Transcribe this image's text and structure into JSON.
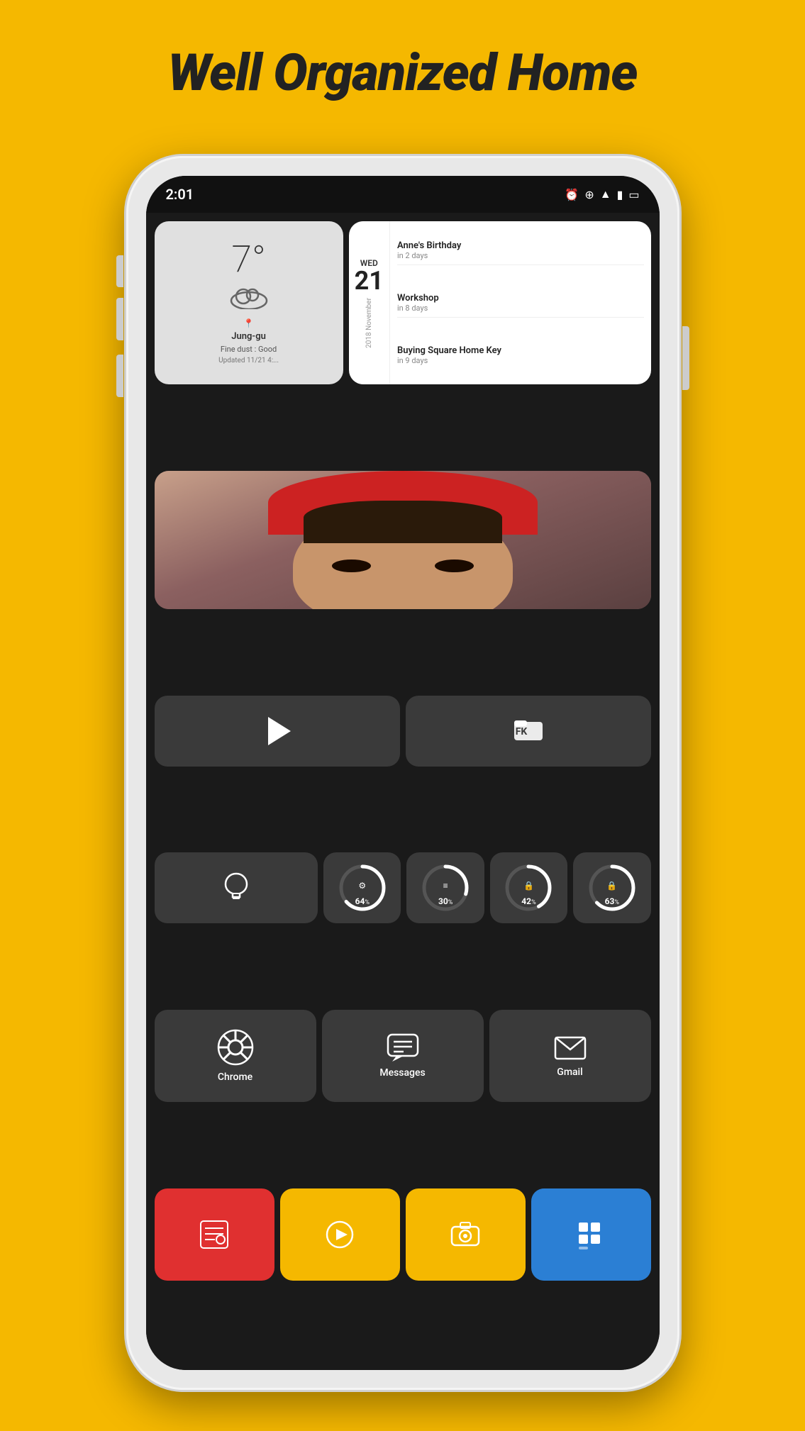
{
  "header": {
    "title": "Well Organized Home"
  },
  "statusBar": {
    "time": "2:01",
    "icons": [
      "alarm-clock",
      "location",
      "wifi",
      "signal",
      "battery"
    ]
  },
  "weatherWidget": {
    "temperature": "7°",
    "location": "Jung-gu",
    "fineDust": "Fine dust : Good",
    "updated": "Updated 11/21 4:...",
    "icon": "cloud"
  },
  "calendarWidget": {
    "dayName": "WED",
    "dayNum": "21",
    "yearMonth": "2018 November",
    "events": [
      {
        "name": "Anne's Birthday",
        "days": "in 2 days"
      },
      {
        "name": "Workshop",
        "days": "in 8 days"
      },
      {
        "name": "Buying Square Home Key",
        "days": "in 9 days"
      }
    ]
  },
  "usageCircles": [
    {
      "icon": "⚙",
      "value": "64",
      "pct": "%"
    },
    {
      "icon": "≡",
      "value": "30",
      "pct": "%"
    },
    {
      "icon": "🔒",
      "value": "42",
      "pct": "%"
    },
    {
      "icon": "🔒",
      "value": "63",
      "pct": "%"
    }
  ],
  "mainApps": [
    {
      "name": "Chrome",
      "iconType": "chrome"
    },
    {
      "name": "Messages",
      "iconType": "messages"
    },
    {
      "name": "Gmail",
      "iconType": "gmail"
    }
  ],
  "dockApps": [
    {
      "name": "Contacts",
      "iconType": "contacts",
      "color": "red"
    },
    {
      "name": "Play",
      "iconType": "play",
      "color": "yellow"
    },
    {
      "name": "Camera",
      "iconType": "camera",
      "color": "yellow"
    },
    {
      "name": "Grid",
      "iconType": "grid",
      "color": "blue"
    }
  ]
}
